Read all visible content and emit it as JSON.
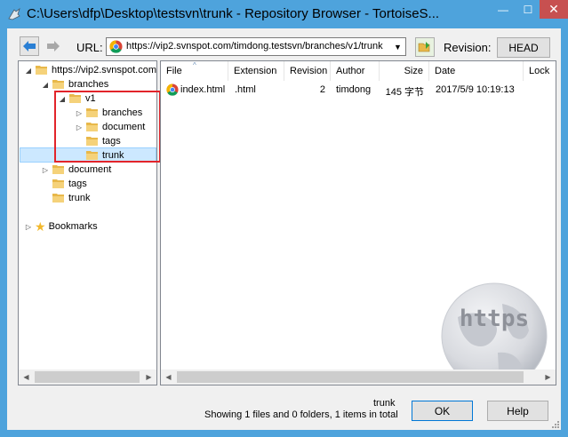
{
  "window": {
    "title": "C:\\Users\\dfp\\Desktop\\testsvn\\trunk - Repository Browser - TortoiseS...",
    "minimize": "—",
    "maximize": "☐",
    "close": "✕"
  },
  "toolbar": {
    "url_label": "URL:",
    "url_value": "https://vip2.svnspot.com/timdong.testsvn/branches/v1/trunk",
    "revision_label": "Revision:",
    "revision_button": "HEAD"
  },
  "tree": {
    "root": "https://vip2.svnspot.com",
    "branches": "branches",
    "v1": "v1",
    "v1_branches": "branches",
    "v1_document": "document",
    "v1_tags": "tags",
    "v1_trunk": "trunk",
    "document": "document",
    "tags": "tags",
    "trunk": "trunk",
    "bookmarks": "Bookmarks"
  },
  "list": {
    "columns": [
      "File",
      "Extension",
      "Revision",
      "Author",
      "Size",
      "Date",
      "Lock"
    ],
    "rows": [
      {
        "file": "index.html",
        "extension": ".html",
        "revision": "2",
        "author": "timdong",
        "size": "145 字节",
        "date": "2017/5/9 10:19:13",
        "lock": ""
      }
    ]
  },
  "watermark": {
    "text": "https"
  },
  "status": {
    "current": "trunk",
    "summary": "Showing 1 files and 0 folders, 1 items in total"
  },
  "buttons": {
    "ok": "OK",
    "help": "Help"
  },
  "colors": {
    "titlebar": "#4ea3dc",
    "close": "#c75050",
    "selection": "#cce8ff",
    "highlight_box": "#e2242a",
    "folder": "#e8b84a"
  }
}
